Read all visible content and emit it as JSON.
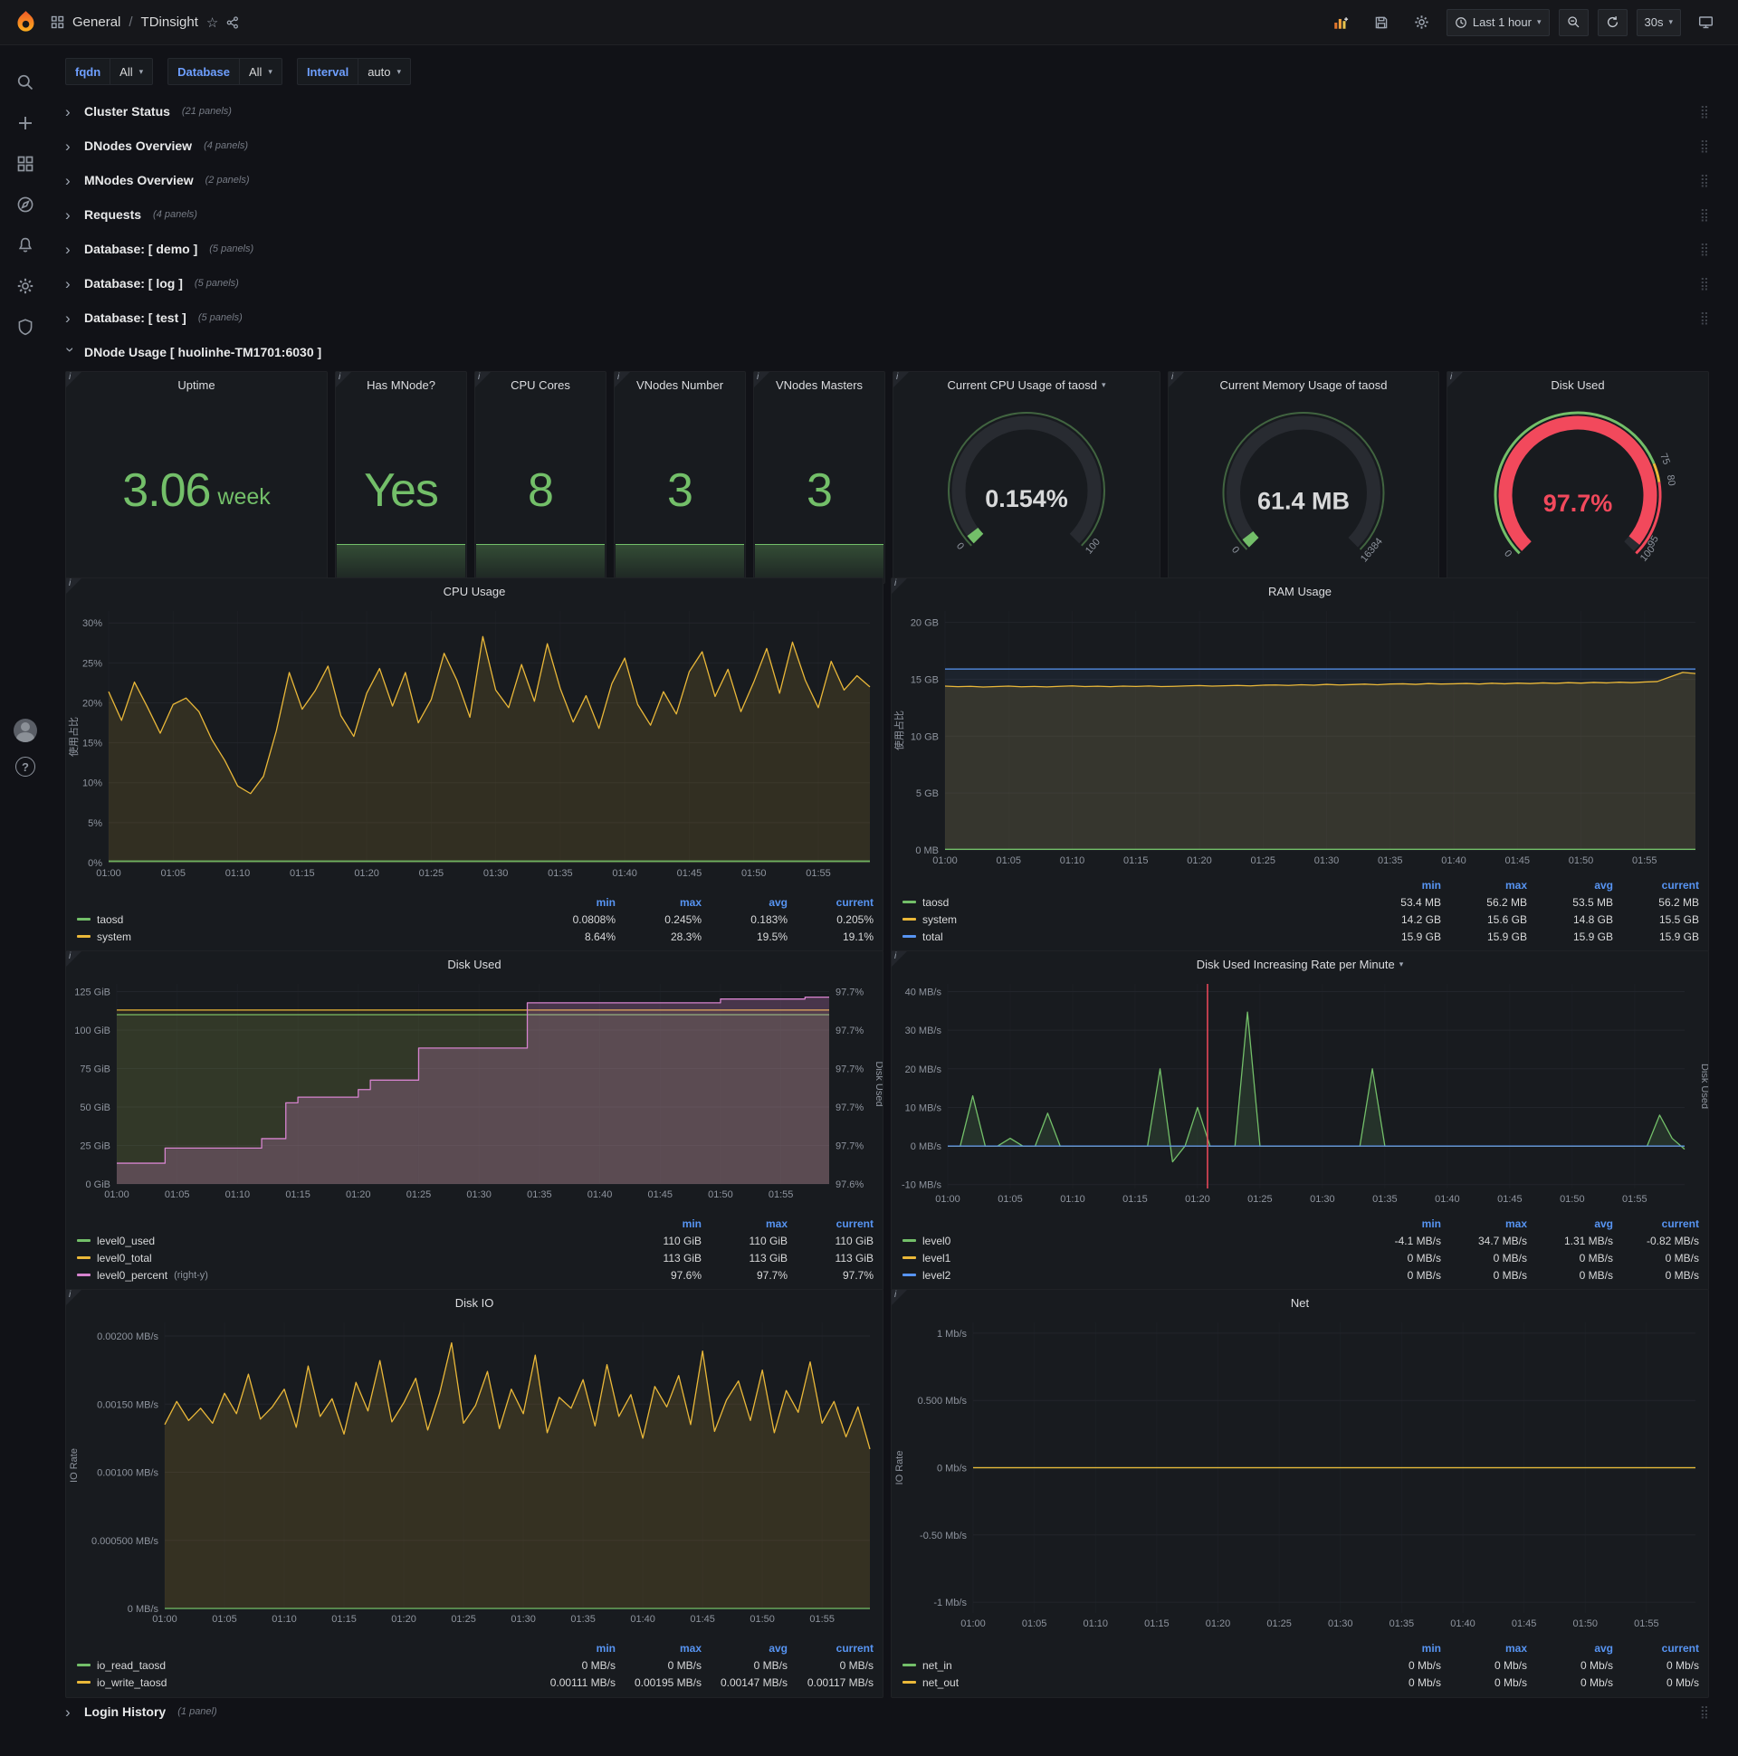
{
  "topbar": {
    "breadcrumb_section": "General",
    "breadcrumb_sep": "/",
    "breadcrumb_title": "TDinsight",
    "time_range": "Last 1 hour",
    "refresh": "30s"
  },
  "variables": [
    {
      "label": "fqdn",
      "value": "All"
    },
    {
      "label": "Database",
      "value": "All"
    },
    {
      "label": "Interval",
      "value": "auto"
    }
  ],
  "collapsed_rows_top": [
    {
      "title": "Cluster Status",
      "count": "(21 panels)"
    },
    {
      "title": "DNodes Overview",
      "count": "(4 panels)"
    },
    {
      "title": "MNodes Overview",
      "count": "(2 panels)"
    },
    {
      "title": "Requests",
      "count": "(4 panels)"
    },
    {
      "title": "Database: [ demo ]",
      "count": "(5 panels)"
    },
    {
      "title": "Database: [ log ]",
      "count": "(5 panels)"
    },
    {
      "title": "Database: [ test ]",
      "count": "(5 panels)"
    }
  ],
  "expanded_row": {
    "title": "DNode Usage [ huolinhe-TM1701:6030 ]"
  },
  "collapsed_rows_bottom": [
    {
      "title": "Login History",
      "count": "(1 panel)"
    }
  ],
  "stats": [
    {
      "title": "Uptime",
      "value": "3.06",
      "unit": "week"
    },
    {
      "title": "Has MNode?",
      "value": "Yes",
      "unit": ""
    },
    {
      "title": "CPU Cores",
      "value": "8",
      "unit": ""
    },
    {
      "title": "VNodes Number",
      "value": "3",
      "unit": ""
    },
    {
      "title": "VNodes Masters",
      "value": "3",
      "unit": ""
    }
  ],
  "gauges": [
    {
      "title": "Current CPU Usage of taosd",
      "value": "0.154%",
      "fraction": 0.00154,
      "min_label": "0",
      "max_label": "100",
      "arc_color": "#73bf69",
      "value_color": "#d8d9da"
    },
    {
      "title": "Current Memory Usage of taosd",
      "value": "61.4 MB",
      "fraction": 0.0037,
      "min_label": "0",
      "max_label": "16384",
      "arc_color": "#73bf69",
      "value_color": "#d8d9da"
    },
    {
      "title": "Disk Used",
      "value": "97.7%",
      "fraction": 0.977,
      "min_label": "0",
      "max_label": "100",
      "arc_color": "#f2495c",
      "value_color": "#f2495c",
      "tick_labels": [
        {
          "at": 0.75,
          "label": "75"
        },
        {
          "at": 0.8,
          "label": "80"
        },
        {
          "at": 0.95,
          "label": "95"
        }
      ],
      "threshold_ring": [
        {
          "from": 0,
          "to": 0.75,
          "color": "#73bf69"
        },
        {
          "from": 0.75,
          "to": 0.8,
          "color": "#eab839"
        },
        {
          "from": 0.8,
          "to": 1,
          "color": "#f2495c"
        }
      ]
    }
  ],
  "chart_data": [
    {
      "type": "line",
      "title": "CPU Usage",
      "ylabel": "使用占比",
      "points": 60,
      "ymin": 0,
      "ymax": 31.5,
      "yticks": [
        0,
        5,
        10,
        15,
        20,
        25,
        30
      ],
      "ytick_labels": [
        "0%",
        "5%",
        "10%",
        "15%",
        "20%",
        "25%",
        "30%"
      ],
      "xticks": [
        "01:00",
        "01:05",
        "01:10",
        "01:15",
        "01:20",
        "01:25",
        "01:30",
        "01:35",
        "01:40",
        "01:45",
        "01:50",
        "01:55"
      ],
      "series": [
        {
          "name": "system",
          "color": "#eab839",
          "fill": 0.13,
          "values": [
            21.4,
            17.8,
            22.6,
            19.5,
            16.2,
            19.8,
            20.6,
            18.9,
            15.4,
            12.8,
            9.6,
            8.64,
            10.8,
            16.5,
            23.8,
            19.2,
            21.5,
            24.6,
            18.4,
            15.8,
            21.2,
            24.3,
            19.6,
            23.8,
            17.5,
            20.4,
            26.2,
            22.8,
            18.2,
            28.3,
            21.6,
            19.4,
            24.8,
            20.2,
            27.4,
            21.8,
            17.6,
            20.9,
            16.8,
            22.4,
            25.6,
            19.8,
            17.2,
            21.4,
            18.6,
            23.9,
            26.4,
            20.8,
            24.2,
            18.9,
            22.6,
            26.8,
            21.2,
            27.6,
            22.8,
            19.4,
            25.2,
            21.6,
            23.4,
            22.0
          ]
        },
        {
          "name": "taosd",
          "color": "#73bf69",
          "fill": 0.3,
          "values": 0.2
        }
      ],
      "legend": {
        "cols": [
          "min",
          "max",
          "avg",
          "current"
        ],
        "rows": [
          {
            "name": "taosd",
            "color": "#73bf69",
            "values": [
              "0.0808%",
              "0.245%",
              "0.183%",
              "0.205%"
            ]
          },
          {
            "name": "system",
            "color": "#eab839",
            "values": [
              "8.64%",
              "28.3%",
              "19.5%",
              "19.1%"
            ]
          }
        ]
      }
    },
    {
      "type": "line",
      "title": "RAM Usage",
      "ylabel": "使用占比",
      "points": 60,
      "ymin": 0,
      "ymax": 21,
      "yticks": [
        0,
        5,
        10,
        15,
        20
      ],
      "ytick_labels": [
        "0 MB",
        "5 GB",
        "10 GB",
        "15 GB",
        "20 GB"
      ],
      "xticks": [
        "01:00",
        "01:05",
        "01:10",
        "01:15",
        "01:20",
        "01:25",
        "01:30",
        "01:35",
        "01:40",
        "01:45",
        "01:50",
        "01:55"
      ],
      "series": [
        {
          "name": "total",
          "color": "#5794f2",
          "fill": 0.07,
          "values": 15.9
        },
        {
          "name": "system",
          "color": "#eab839",
          "fill": 0.13,
          "values": [
            14.4,
            14.35,
            14.38,
            14.32,
            14.36,
            14.4,
            14.34,
            14.37,
            14.33,
            14.38,
            14.42,
            14.36,
            14.39,
            14.35,
            14.4,
            14.37,
            14.41,
            14.36,
            14.38,
            14.42,
            14.45,
            14.4,
            14.43,
            14.46,
            14.42,
            14.48,
            14.5,
            14.46,
            14.52,
            14.48,
            14.55,
            14.5,
            14.53,
            14.57,
            14.52,
            14.58,
            14.6,
            14.55,
            14.62,
            14.58,
            14.6,
            14.63,
            14.58,
            14.65,
            14.6,
            14.66,
            14.62,
            14.68,
            14.64,
            14.7,
            14.66,
            14.72,
            14.68,
            14.74,
            14.7,
            14.76,
            14.8,
            15.2,
            15.6,
            15.5
          ]
        },
        {
          "name": "taosd",
          "color": "#73bf69",
          "fill": 0.3,
          "values": 0.055
        }
      ],
      "legend": {
        "cols": [
          "min",
          "max",
          "avg",
          "current"
        ],
        "rows": [
          {
            "name": "taosd",
            "color": "#73bf69",
            "values": [
              "53.4 MB",
              "56.2 MB",
              "53.5 MB",
              "56.2 MB"
            ]
          },
          {
            "name": "system",
            "color": "#eab839",
            "values": [
              "14.2 GB",
              "15.6 GB",
              "14.8 GB",
              "15.5 GB"
            ]
          },
          {
            "name": "total",
            "color": "#5794f2",
            "values": [
              "15.9 GB",
              "15.9 GB",
              "15.9 GB",
              "15.9 GB"
            ]
          }
        ]
      }
    },
    {
      "type": "line",
      "title": "Disk Used",
      "ylabel": "",
      "points": 60,
      "ymin": 0,
      "ymax": 130,
      "yticks": [
        0,
        25,
        50,
        75,
        100,
        125
      ],
      "ytick_labels": [
        "0 GiB",
        "25 GiB",
        "50 GiB",
        "75 GiB",
        "100 GiB",
        "125 GiB"
      ],
      "right_axis": {
        "min": 97.6,
        "max": 97.706,
        "label": "Disk Used",
        "tick_labels": [
          "97.6%",
          "97.7%",
          "97.7%",
          "97.7%",
          "97.7%",
          "97.7%"
        ]
      },
      "xticks": [
        "01:00",
        "01:05",
        "01:10",
        "01:15",
        "01:20",
        "01:25",
        "01:30",
        "01:35",
        "01:40",
        "01:45",
        "01:50",
        "01:55"
      ],
      "series": [
        {
          "name": "level0_used",
          "color": "#73bf69",
          "fill": 0.12,
          "values": 110
        },
        {
          "name": "level0_total",
          "color": "#eab839",
          "fill": 0.08,
          "values": 113
        },
        {
          "name": "level0_percent",
          "color": "#d683ce",
          "fill": 0.25,
          "axis": "right",
          "step": true,
          "values": [
            97.611,
            97.611,
            97.611,
            97.611,
            97.619,
            97.619,
            97.619,
            97.619,
            97.619,
            97.619,
            97.619,
            97.619,
            97.624,
            97.624,
            97.643,
            97.646,
            97.646,
            97.646,
            97.646,
            97.646,
            97.65,
            97.655,
            97.655,
            97.655,
            97.655,
            97.672,
            97.672,
            97.672,
            97.672,
            97.672,
            97.672,
            97.672,
            97.672,
            97.672,
            97.696,
            97.696,
            97.696,
            97.696,
            97.696,
            97.696,
            97.696,
            97.696,
            97.696,
            97.696,
            97.696,
            97.696,
            97.696,
            97.696,
            97.696,
            97.696,
            97.698,
            97.698,
            97.698,
            97.698,
            97.698,
            97.698,
            97.698,
            97.699,
            97.699,
            97.699
          ]
        }
      ],
      "legend": {
        "cols": [
          "min",
          "max",
          "current"
        ],
        "rows": [
          {
            "name": "level0_used",
            "color": "#73bf69",
            "values": [
              "110 GiB",
              "110 GiB",
              "110 GiB"
            ]
          },
          {
            "name": "level0_total",
            "color": "#eab839",
            "values": [
              "113 GiB",
              "113 GiB",
              "113 GiB"
            ]
          },
          {
            "name": "level0_percent",
            "color": "#d683ce",
            "note": "(right-y)",
            "values": [
              "97.6%",
              "97.7%",
              "97.7%"
            ]
          }
        ]
      }
    },
    {
      "type": "line",
      "title": "Disk Used Increasing Rate per Minute",
      "ylabel": "",
      "points": 60,
      "ymin": -11,
      "ymax": 42,
      "yticks": [
        -10,
        0,
        10,
        20,
        30,
        40
      ],
      "ytick_labels": [
        "-10 MB/s",
        "0 MB/s",
        "10 MB/s",
        "20 MB/s",
        "30 MB/s",
        "40 MB/s"
      ],
      "right_label": "Disk Used",
      "annotation_x": 20.8,
      "xticks": [
        "01:00",
        "01:05",
        "01:10",
        "01:15",
        "01:20",
        "01:25",
        "01:30",
        "01:35",
        "01:40",
        "01:45",
        "01:50",
        "01:55"
      ],
      "series": [
        {
          "name": "level0",
          "color": "#73bf69",
          "fill": 0.15,
          "values": [
            0,
            0,
            13,
            0,
            0,
            2,
            0,
            0,
            8.5,
            0,
            0,
            0,
            0,
            0,
            0,
            0,
            0,
            20,
            -4.1,
            0,
            10,
            0,
            0,
            0,
            34.7,
            0,
            0,
            0,
            0,
            0,
            0,
            0,
            0,
            0,
            20,
            0,
            0,
            0,
            0,
            0,
            0,
            0,
            0,
            0,
            0,
            0,
            0,
            0,
            0,
            0,
            0,
            0,
            0,
            0,
            0,
            0,
            0,
            8,
            2,
            -0.82
          ]
        },
        {
          "name": "level1",
          "color": "#eab839",
          "fill": 0,
          "values": 0
        },
        {
          "name": "level2",
          "color": "#5794f2",
          "fill": 0,
          "values": 0
        }
      ],
      "legend": {
        "cols": [
          "min",
          "max",
          "avg",
          "current"
        ],
        "rows": [
          {
            "name": "level0",
            "color": "#73bf69",
            "values": [
              "-4.1 MB/s",
              "34.7 MB/s",
              "1.31 MB/s",
              "-0.82 MB/s"
            ]
          },
          {
            "name": "level1",
            "color": "#eab839",
            "values": [
              "0 MB/s",
              "0 MB/s",
              "0 MB/s",
              "0 MB/s"
            ]
          },
          {
            "name": "level2",
            "color": "#5794f2",
            "values": [
              "0 MB/s",
              "0 MB/s",
              "0 MB/s",
              "0 MB/s"
            ]
          }
        ]
      }
    },
    {
      "type": "line",
      "title": "Disk IO",
      "ylabel": "IO Rate",
      "points": 60,
      "ymin": 0,
      "ymax": 0.0021,
      "yticks": [
        0,
        0.0005,
        0.001,
        0.0015,
        0.002
      ],
      "ytick_labels": [
        "0 MB/s",
        "0.000500 MB/s",
        "0.00100 MB/s",
        "0.00150 MB/s",
        "0.00200 MB/s"
      ],
      "xticks": [
        "01:00",
        "01:05",
        "01:10",
        "01:15",
        "01:20",
        "01:25",
        "01:30",
        "01:35",
        "01:40",
        "01:45",
        "01:50",
        "01:55"
      ],
      "series": [
        {
          "name": "io_write_taosd",
          "color": "#eab839",
          "fill": 0.14,
          "values": [
            0.00135,
            0.00152,
            0.00138,
            0.00147,
            0.00136,
            0.00158,
            0.00143,
            0.00172,
            0.00139,
            0.00148,
            0.00161,
            0.00133,
            0.00178,
            0.00141,
            0.00154,
            0.00128,
            0.00166,
            0.00145,
            0.00182,
            0.00137,
            0.00151,
            0.00169,
            0.00131,
            0.00158,
            0.00195,
            0.00136,
            0.00149,
            0.00174,
            0.00132,
            0.00161,
            0.00143,
            0.00186,
            0.00129,
            0.00155,
            0.00147,
            0.00168,
            0.00134,
            0.00179,
            0.00141,
            0.00157,
            0.00125,
            0.00163,
            0.00148,
            0.00171,
            0.00135,
            0.00189,
            0.0013,
            0.00153,
            0.00167,
            0.00138,
            0.00175,
            0.00129,
            0.0016,
            0.00144,
            0.00181,
            0.00136,
            0.00152,
            0.00126,
            0.00148,
            0.00117
          ]
        },
        {
          "name": "io_read_taosd",
          "color": "#73bf69",
          "fill": 0.2,
          "values": 0
        }
      ],
      "legend": {
        "cols": [
          "min",
          "max",
          "avg",
          "current"
        ],
        "rows": [
          {
            "name": "io_read_taosd",
            "color": "#73bf69",
            "values": [
              "0 MB/s",
              "0 MB/s",
              "0 MB/s",
              "0 MB/s"
            ]
          },
          {
            "name": "io_write_taosd",
            "color": "#eab839",
            "values": [
              "0.00111 MB/s",
              "0.00195 MB/s",
              "0.00147 MB/s",
              "0.00117 MB/s"
            ]
          }
        ]
      }
    },
    {
      "type": "line",
      "title": "Net",
      "ylabel": "IO Rate",
      "points": 60,
      "ymin": -1.08,
      "ymax": 1.08,
      "yticks": [
        -1,
        -0.5,
        0,
        0.5,
        1
      ],
      "ytick_labels": [
        "-1 Mb/s",
        "-0.50 Mb/s",
        "0 Mb/s",
        "0.500 Mb/s",
        "1 Mb/s"
      ],
      "xticks": [
        "01:00",
        "01:05",
        "01:10",
        "01:15",
        "01:20",
        "01:25",
        "01:30",
        "01:35",
        "01:40",
        "01:45",
        "01:50",
        "01:55"
      ],
      "series": [
        {
          "name": "net_in",
          "color": "#73bf69",
          "fill": 0,
          "values": 0
        },
        {
          "name": "net_out",
          "color": "#eab839",
          "fill": 0,
          "values": 0
        }
      ],
      "legend": {
        "cols": [
          "min",
          "max",
          "avg",
          "current"
        ],
        "rows": [
          {
            "name": "net_in",
            "color": "#73bf69",
            "values": [
              "0 Mb/s",
              "0 Mb/s",
              "0 Mb/s",
              "0 Mb/s"
            ]
          },
          {
            "name": "net_out",
            "color": "#eab839",
            "values": [
              "0 Mb/s",
              "0 Mb/s",
              "0 Mb/s",
              "0 Mb/s"
            ]
          }
        ]
      }
    }
  ]
}
